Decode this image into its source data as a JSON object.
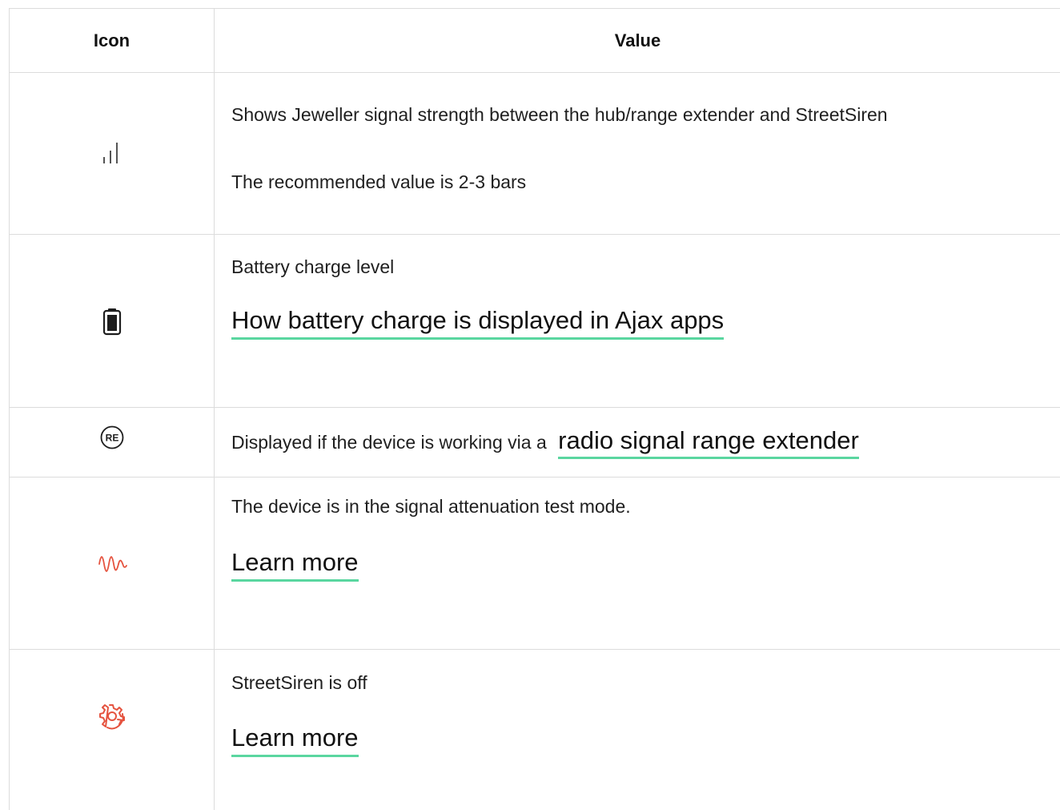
{
  "table": {
    "headers": {
      "icon": "Icon",
      "value": "Value"
    },
    "rows": [
      {
        "icon_name": "signal-strength-icon",
        "lines": [
          "Shows Jeweller signal strength between the hub/range extender and StreetSiren",
          "The recommended value is 2-3 bars"
        ]
      },
      {
        "icon_name": "battery-icon",
        "lines": [
          "Battery charge level"
        ],
        "link": "How battery charge is displayed in Ajax apps"
      },
      {
        "icon_name": "range-extender-icon",
        "icon_text": "RE",
        "text": "Displayed if the device is working via a ",
        "link": "radio signal range extender"
      },
      {
        "icon_name": "signal-attenuation-icon",
        "lines": [
          "The device is in the signal attenuation test mode."
        ],
        "link": "Learn more"
      },
      {
        "icon_name": "device-off-icon",
        "lines": [
          "StreetSiren is off"
        ],
        "link": "Learn more"
      }
    ]
  },
  "colors": {
    "link_underline": "#5ad6a0",
    "alert_icon": "#e5533f",
    "border": "#dcdcdc"
  }
}
